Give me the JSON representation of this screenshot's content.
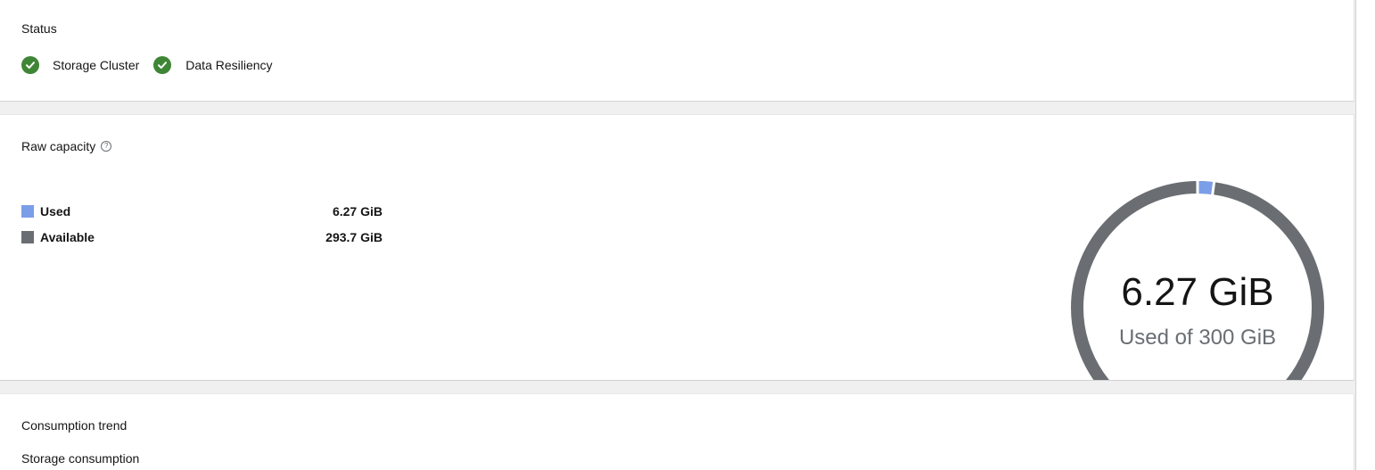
{
  "status": {
    "title": "Status",
    "items": [
      {
        "label": "Storage Cluster",
        "state": "healthy"
      },
      {
        "label": "Data Resiliency",
        "state": "healthy"
      }
    ]
  },
  "capacity": {
    "title": "Raw capacity",
    "help_icon": "?",
    "legend": [
      {
        "label": "Used",
        "value": "6.27 GiB",
        "color": "#7b9ee8"
      },
      {
        "label": "Available",
        "value": "293.7 GiB",
        "color": "#6a6e73"
      }
    ],
    "donut": {
      "used_value": 6.27,
      "total_value": 300,
      "main_label": "6.27 GiB",
      "sub_label": "Used of 300 GiB"
    }
  },
  "trend": {
    "title": "Consumption trend",
    "subtitle": "Storage consumption"
  },
  "colors": {
    "healthy": "#3e8635",
    "used": "#7b9ee8",
    "available": "#6a6e73"
  }
}
